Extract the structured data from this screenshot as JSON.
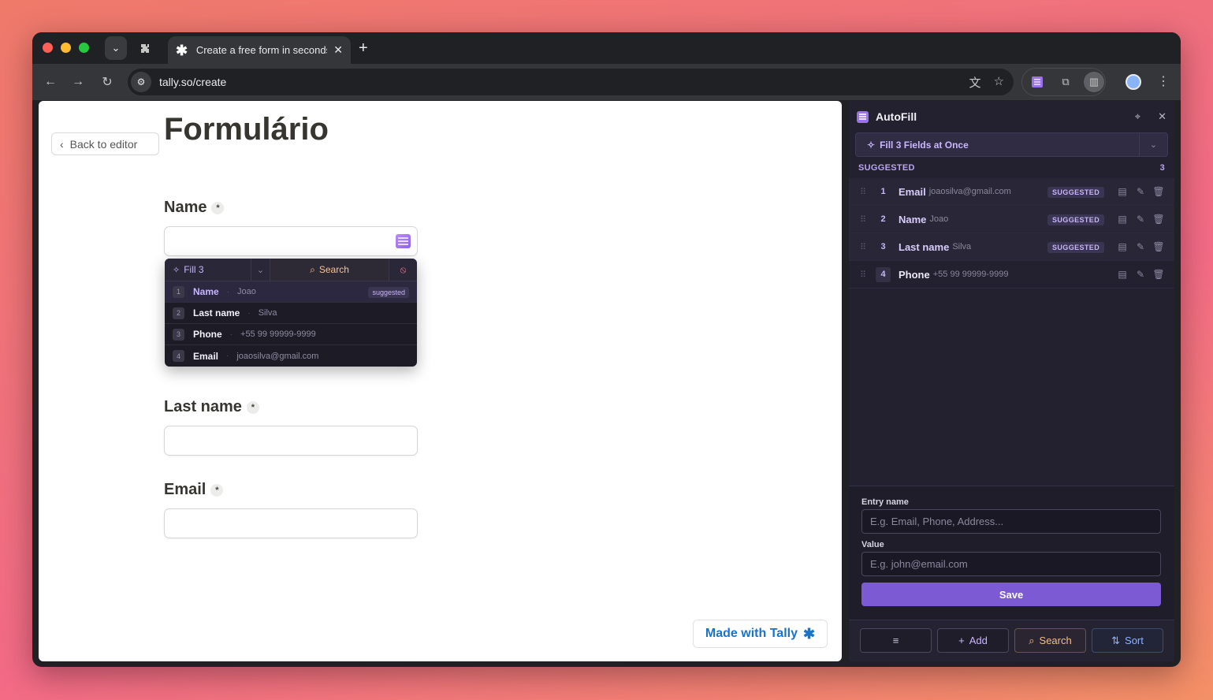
{
  "browser": {
    "tab_title": "Create a free form in seconds",
    "tab_icon": "asterisk-icon",
    "url": "tally.so/create"
  },
  "page": {
    "back_label": "Back to editor",
    "form_title": "Formulário",
    "fields": [
      {
        "label": "Name",
        "required": "*"
      },
      {
        "label": "Last name",
        "required": "*"
      },
      {
        "label": "Email",
        "required": "*"
      }
    ],
    "made_with": "Made with Tally",
    "made_with_icon": "asterisk-icon"
  },
  "dropdown": {
    "fill_label": "Fill 3",
    "search_label": "Search",
    "rows": [
      {
        "num": "1",
        "name": "Name",
        "value": "Joao",
        "badge": "suggested"
      },
      {
        "num": "2",
        "name": "Last name",
        "value": "Silva"
      },
      {
        "num": "3",
        "name": "Phone",
        "value": "+55 99 99999-9999"
      },
      {
        "num": "4",
        "name": "Email",
        "value": "joaosilva@gmail.com"
      }
    ]
  },
  "panel": {
    "title": "AutoFill",
    "fill_all_label": "Fill 3 Fields at Once",
    "suggested_heading": "SUGGESTED",
    "suggested_count": "3",
    "entries": [
      {
        "num": "1",
        "name": "Email",
        "value": "joaosilva@gmail.com",
        "badge": "SUGGESTED"
      },
      {
        "num": "2",
        "name": "Name",
        "value": "Joao",
        "badge": "SUGGESTED"
      },
      {
        "num": "3",
        "name": "Last name",
        "value": "Silva",
        "badge": "SUGGESTED"
      },
      {
        "num": "4",
        "name": "Phone",
        "value": "+55 99 99999-9999"
      }
    ],
    "entry_name_label": "Entry name",
    "entry_name_placeholder": "E.g. Email, Phone, Address...",
    "value_label": "Value",
    "value_placeholder": "E.g. john@email.com",
    "save_label": "Save",
    "bottom": {
      "add_label": "Add",
      "search_label": "Search",
      "sort_label": "Sort"
    }
  },
  "colors": {
    "accent": "#7c5ad4",
    "panel_bg": "#23212f",
    "tally_blue": "#1a73c8"
  }
}
